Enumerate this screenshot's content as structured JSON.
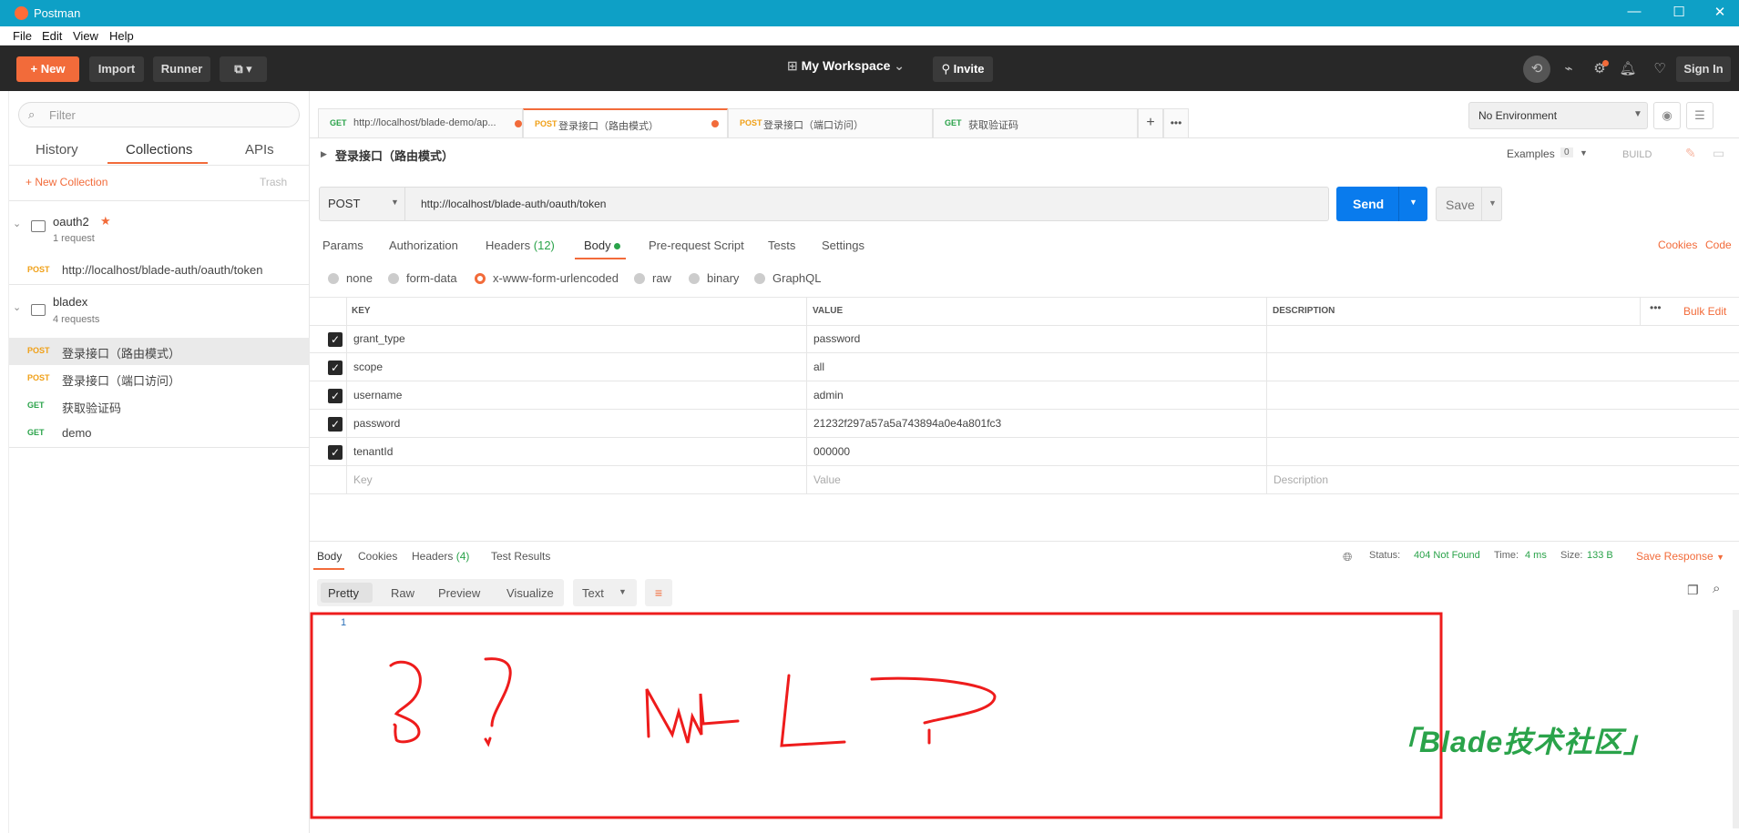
{
  "window": {
    "title": "Postman",
    "minimize": "—",
    "maximize": "☐",
    "close": "✕"
  },
  "menu": [
    "File",
    "Edit",
    "View",
    "Help"
  ],
  "header": {
    "new_label": "New",
    "import_label": "Import",
    "runner_label": "Runner",
    "workspace": "My Workspace",
    "invite": "Invite",
    "signin": "Sign In"
  },
  "sidebar": {
    "filter_placeholder": "Filter",
    "tabs": [
      "History",
      "Collections",
      "APIs"
    ],
    "new_collection": "+ New Collection",
    "trash": "Trash",
    "collections": [
      {
        "name": "oauth2",
        "count": "1 request",
        "requests": [
          {
            "method": "POST",
            "name": "http://localhost/blade-auth/oauth/token"
          }
        ]
      },
      {
        "name": "bladex",
        "count": "4 requests",
        "requests": [
          {
            "method": "POST",
            "name": "登录接口（路由模式）"
          },
          {
            "method": "POST",
            "name": "登录接口（端口访问）"
          },
          {
            "method": "GET",
            "name": "获取验证码"
          },
          {
            "method": "GET",
            "name": "demo"
          }
        ]
      }
    ]
  },
  "tabs": [
    {
      "method": "GET",
      "title": "http://localhost/blade-demo/ap..."
    },
    {
      "method": "POST",
      "title": "登录接口（路由模式）"
    },
    {
      "method": "POST",
      "title": "登录接口（端口访问）"
    },
    {
      "method": "GET",
      "title": "获取验证码"
    }
  ],
  "environment": "No Environment",
  "request": {
    "name": "登录接口（路由模式）",
    "examples_label": "Examples",
    "examples_count": "0",
    "build": "BUILD",
    "method": "POST",
    "url": "http://localhost/blade-auth/oauth/token",
    "send": "Send",
    "save": "Save",
    "subtabs": [
      "Params",
      "Authorization",
      "Headers",
      "(12)",
      "Body",
      "Pre-request Script",
      "Tests",
      "Settings"
    ],
    "cookies": "Cookies",
    "code": "Code",
    "body_modes": [
      "none",
      "form-data",
      "x-www-form-urlencoded",
      "raw",
      "binary",
      "GraphQL"
    ],
    "columns": [
      "KEY",
      "VALUE",
      "DESCRIPTION"
    ],
    "bulk_edit": "Bulk Edit",
    "rows": [
      {
        "key": "grant_type",
        "value": "password"
      },
      {
        "key": "scope",
        "value": "all"
      },
      {
        "key": "username",
        "value": "admin"
      },
      {
        "key": "password",
        "value": "21232f297a57a5a743894a0e4a801fc3"
      },
      {
        "key": "tenantId",
        "value": "000000"
      }
    ],
    "placeholders": {
      "key": "Key",
      "value": "Value",
      "description": "Description"
    }
  },
  "response": {
    "tabs": [
      "Body",
      "Cookies",
      "Headers",
      "(4)",
      "Test Results"
    ],
    "status_label": "Status:",
    "status": "404 Not Found",
    "time_label": "Time:",
    "time": "4 ms",
    "size_label": "Size:",
    "size": "133 B",
    "save_response": "Save Response",
    "views": [
      "Pretty",
      "Raw",
      "Preview",
      "Visualize"
    ],
    "format": "Text",
    "line_number": "1"
  },
  "watermark": "Blade技术社区",
  "colors": {
    "accent": "#f26b3a",
    "send": "#097bed",
    "status_ok": "#2aa34a",
    "annotation": "#ee1c1c"
  }
}
